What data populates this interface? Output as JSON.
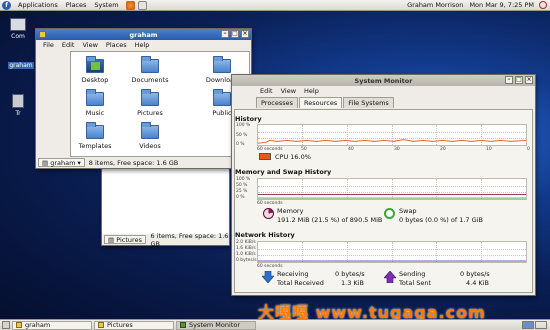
{
  "top_panel": {
    "menus": [
      "Applications",
      "Places",
      "System"
    ],
    "user": "Graham Morrison",
    "clock": "Mon Mar 9,  7:25 PM"
  },
  "desktop": {
    "icons": [
      "Com",
      "graham",
      "Tr"
    ]
  },
  "file_manager": {
    "title": "graham",
    "menus": [
      "File",
      "Edit",
      "View",
      "Places",
      "Help"
    ],
    "items": [
      "Desktop",
      "Documents",
      "Download",
      "Music",
      "Pictures",
      "Public",
      "Templates",
      "Videos"
    ],
    "location": "graham",
    "status": "8 items, Free space: 1.6 GB"
  },
  "pictures_window": {
    "location": "Pictures",
    "status": "6 items, Free space: 1.6 GB"
  },
  "system_monitor": {
    "title": "System Monitor",
    "menus": [
      "Edit",
      "View",
      "Help"
    ],
    "tabs": [
      "Processes",
      "Resources",
      "File Systems"
    ],
    "active_tab": "Resources",
    "cpu": {
      "title": "History",
      "yticks": [
        "100 %",
        "50 %",
        "0 %"
      ],
      "legend": "CPU 16.0%",
      "color": "#e25a1c"
    },
    "memory": {
      "title": "Memory and Swap History",
      "yticks": [
        "100 %",
        "50 %",
        "25 %",
        "0 %"
      ],
      "memory_label": "Memory",
      "memory_value": "191.2 MiB (21.5 %) of 890.5 MiB",
      "swap_label": "Swap",
      "swap_value": "0 bytes (0.0 %) of 1.7 GiB",
      "memory_color": "#8b1a52",
      "swap_color": "#3fa53a"
    },
    "network": {
      "title": "Network History",
      "yticks": [
        "2.0 KiB/s",
        "1.6 KiB/s",
        "1.0 KiB/s",
        "0 bytes/s"
      ],
      "receiving_label": "Receiving",
      "receiving_value": "0 bytes/s",
      "total_received_label": "Total Received",
      "total_received_value": "1.3 KiB",
      "sending_label": "Sending",
      "sending_value": "0 bytes/s",
      "total_sent_label": "Total Sent",
      "total_sent_value": "4.4 KiB",
      "receiving_color": "#2c6fc4",
      "sending_color": "#7b2fb5"
    },
    "xticks": [
      "60 seconds",
      "50",
      "40",
      "30",
      "20",
      "10",
      "0"
    ]
  },
  "taskbar": {
    "tasks": [
      "graham",
      "Pictures",
      "System Monitor"
    ]
  },
  "watermark": "大嘎嘎 www.tugaga.com"
}
